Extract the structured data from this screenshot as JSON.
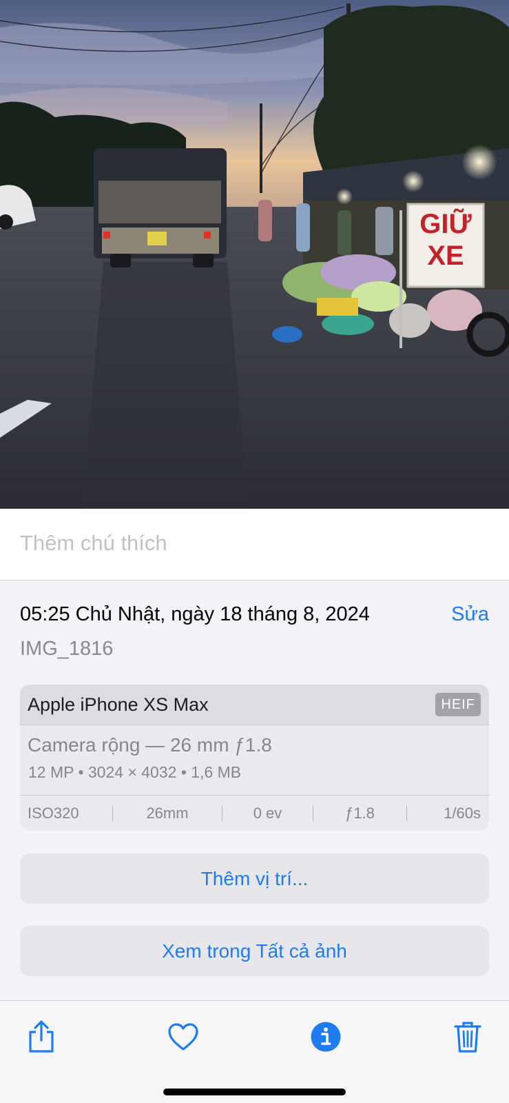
{
  "photo": {
    "sign_line1": "GIỮ",
    "sign_line2": "XE"
  },
  "caption": {
    "placeholder": "Thêm chú thích"
  },
  "info": {
    "datetime": "05:25 Chủ Nhật, ngày 18 tháng 8, 2024",
    "edit_label": "Sửa",
    "filename": "IMG_1816"
  },
  "device": {
    "name": "Apple iPhone XS Max",
    "format": "HEIF",
    "lens": "Camera rộng — 26 mm ƒ1.8",
    "specs": "12 MP  •  3024 × 4032  •  1,6 MB",
    "exif": {
      "iso": "ISO320",
      "focal": "26mm",
      "ev": "0 ev",
      "aperture": "ƒ1.8",
      "shutter": "1/60s"
    }
  },
  "actions": {
    "add_location": "Thêm vị trí...",
    "view_all_photos": "Xem trong Tất cả ảnh"
  },
  "toolbar": {
    "items": [
      {
        "icon": "share-icon"
      },
      {
        "icon": "heart-icon"
      },
      {
        "icon": "info-icon"
      },
      {
        "icon": "trash-icon"
      }
    ]
  },
  "colors": {
    "accent": "#1f7cf0",
    "sheet_background": "#f2f2f7",
    "card_background": "#e9e9ee",
    "secondary_text": "#8a8a8e"
  }
}
